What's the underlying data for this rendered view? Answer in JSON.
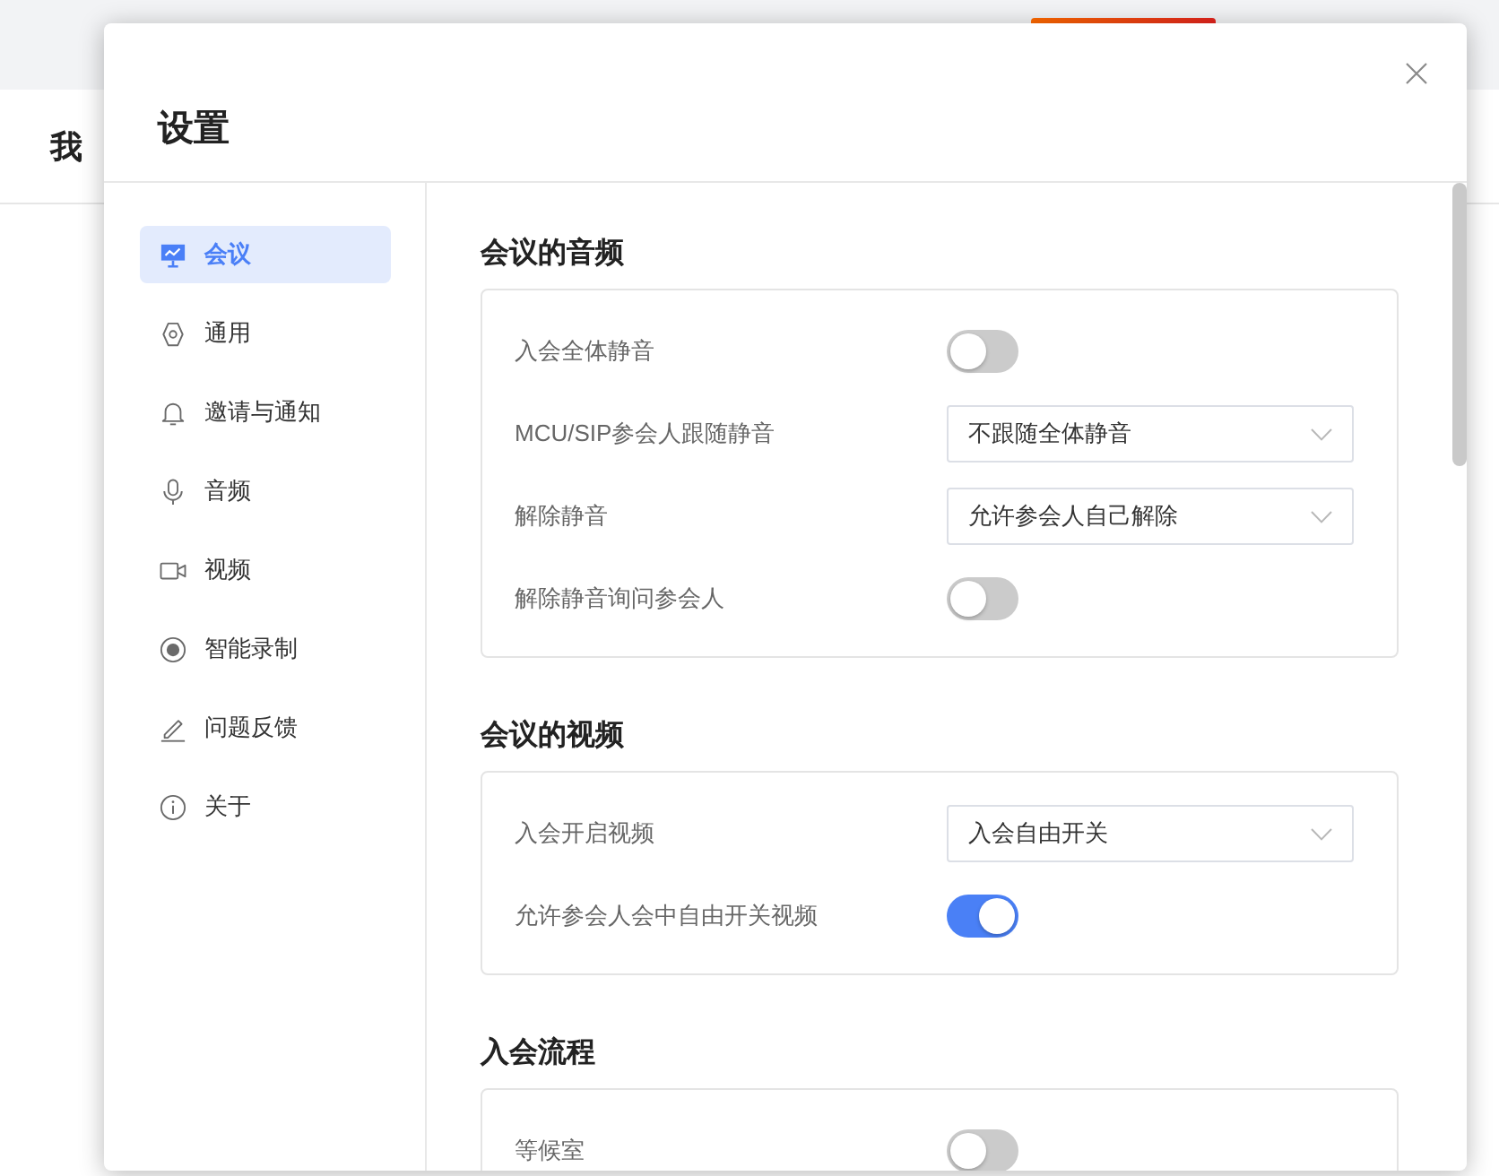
{
  "background": {
    "heading": "我"
  },
  "dialog": {
    "title": "设置"
  },
  "sidebar": {
    "items": [
      {
        "label": "会议",
        "kind": "presentation",
        "selected": true
      },
      {
        "label": "通用",
        "kind": "gear",
        "selected": false
      },
      {
        "label": "邀请与通知",
        "kind": "bell",
        "selected": false
      },
      {
        "label": "音频",
        "kind": "microphone",
        "selected": false
      },
      {
        "label": "视频",
        "kind": "camera",
        "selected": false
      },
      {
        "label": "智能录制",
        "kind": "record",
        "selected": false
      },
      {
        "label": "问题反馈",
        "kind": "pencil",
        "selected": false
      },
      {
        "label": "关于",
        "kind": "info",
        "selected": false
      }
    ]
  },
  "sections": [
    {
      "title": "会议的音频",
      "rows": [
        {
          "label": "入会全体静音",
          "kind": "toggle",
          "on": false
        },
        {
          "label": "MCU/SIP参会人跟随静音",
          "kind": "select",
          "value": "不跟随全体静音"
        },
        {
          "label": "解除静音",
          "kind": "select",
          "value": "允许参会人自己解除"
        },
        {
          "label": "解除静音询问参会人",
          "kind": "toggle",
          "on": false
        }
      ]
    },
    {
      "title": "会议的视频",
      "rows": [
        {
          "label": "入会开启视频",
          "kind": "select",
          "value": "入会自由开关"
        },
        {
          "label": "允许参会人会中自由开关视频",
          "kind": "toggle",
          "on": true
        }
      ]
    },
    {
      "title": "入会流程",
      "rows": [
        {
          "label": "等候室",
          "kind": "toggle",
          "on": false
        }
      ]
    }
  ]
}
